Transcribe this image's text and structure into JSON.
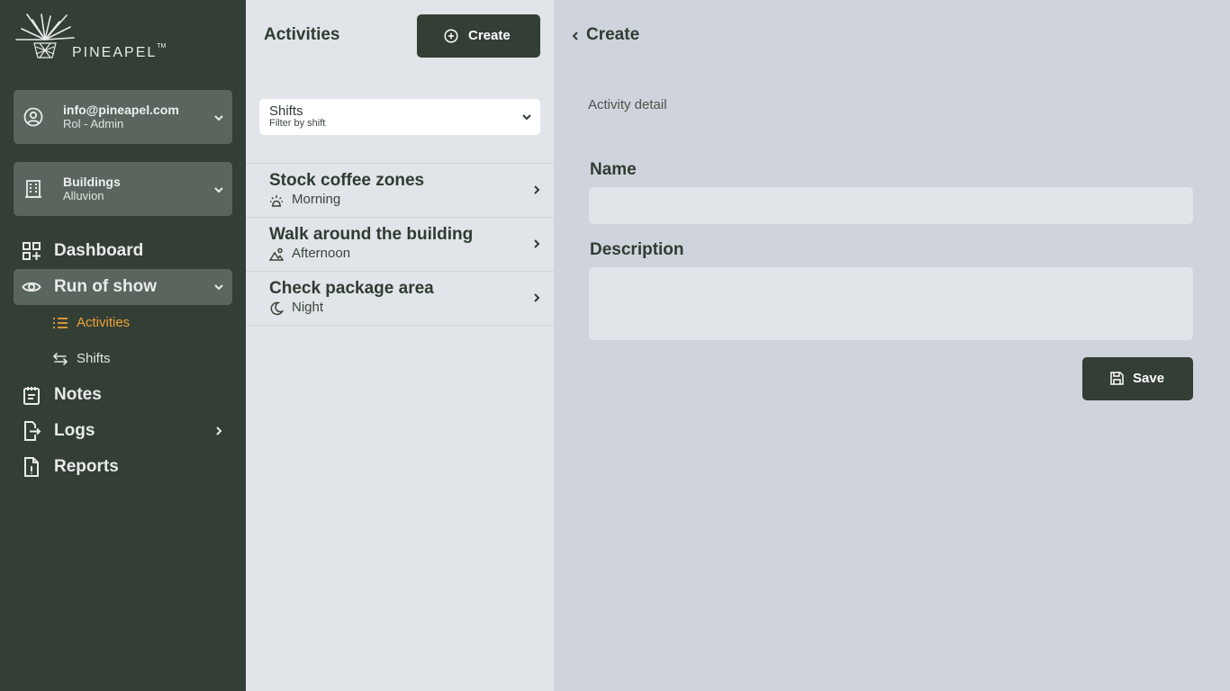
{
  "brand": {
    "name": "PINEAPEL",
    "trademark": "TM"
  },
  "user": {
    "email": "info@pineapel.com",
    "role": "Rol - Admin"
  },
  "building": {
    "title": "Buildings",
    "name": "Alluvion"
  },
  "nav": {
    "dashboard": "Dashboard",
    "run_of_show": "Run of show",
    "activities": "Activities",
    "shifts": "Shifts",
    "notes": "Notes",
    "logs": "Logs",
    "reports": "Reports"
  },
  "list_panel": {
    "title": "Activities",
    "create_label": "Create",
    "filter": {
      "label": "Shifts",
      "hint": "Filter by shift"
    },
    "items": [
      {
        "title": "Stock coffee zones",
        "shift": "Morning",
        "icon": "sunrise-icon"
      },
      {
        "title": "Walk around the building",
        "shift": "Afternoon",
        "icon": "mountain-sun-icon"
      },
      {
        "title": "Check package area",
        "shift": "Night",
        "icon": "moon-icon"
      }
    ]
  },
  "detail": {
    "back_label": "Create",
    "section": "Activity detail",
    "name_label": "Name",
    "name_value": "",
    "description_label": "Description",
    "description_value": "",
    "save_label": "Save"
  },
  "colors": {
    "sidebar": "#333e35",
    "card": "#5a665d",
    "accent": "#eda23a",
    "list_bg": "#e1e4e8",
    "detail_bg": "#cfd3db"
  }
}
